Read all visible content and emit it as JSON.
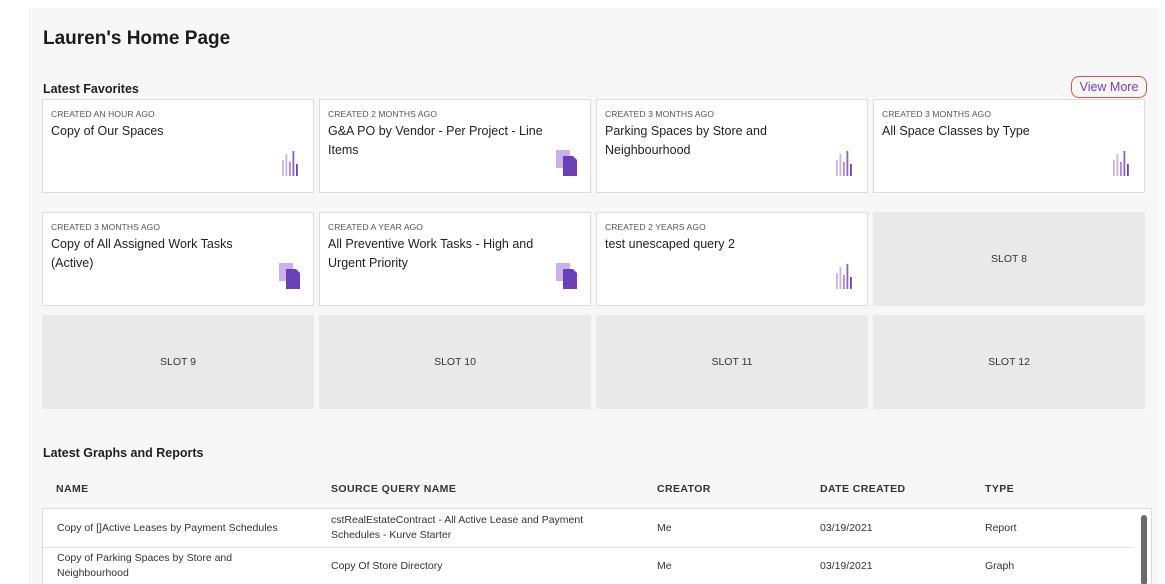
{
  "page": {
    "title": "Lauren's Home Page"
  },
  "favorites": {
    "title": "Latest Favorites",
    "view_more": "View More",
    "cards": [
      {
        "created": "CREATED AN HOUR AGO",
        "name": "Copy of Our Spaces",
        "icon": "bar-chart-icon"
      },
      {
        "created": "CREATED 2 MONTHS AGO",
        "name": "G&A PO by Vendor - Per Project - Line Items",
        "icon": "report-icon"
      },
      {
        "created": "CREATED 3 MONTHS AGO",
        "name": "Parking Spaces by Store and Neighbourhood",
        "icon": "bar-chart-icon"
      },
      {
        "created": "CREATED 3 MONTHS AGO",
        "name": "All Space Classes by Type",
        "icon": "bar-chart-icon"
      },
      {
        "created": "CREATED 3 MONTHS AGO",
        "name": "Copy of All Assigned Work Tasks (Active)",
        "icon": "report-icon"
      },
      {
        "created": "CREATED A YEAR AGO",
        "name": "All Preventive Work Tasks - High and Urgent Priority",
        "icon": "report-icon"
      },
      {
        "created": "CREATED 2 YEARS AGO",
        "name": "test unescaped query 2",
        "icon": "bar-chart-icon"
      }
    ],
    "slots": [
      "SLOT 8",
      "SLOT 9",
      "SLOT 10",
      "SLOT 11",
      "SLOT 12"
    ]
  },
  "reports": {
    "title": "Latest Graphs and Reports",
    "columns": [
      "NAME",
      "SOURCE QUERY NAME",
      "CREATOR",
      "DATE CREATED",
      "TYPE"
    ],
    "rows": [
      {
        "name": "Copy of []Active Leases by Payment Schedules",
        "source": "cstRealEstateContract - All Active Lease and Payment Schedules - Kurve Starter",
        "creator": "Me",
        "date": "03/19/2021",
        "type": "Report"
      },
      {
        "name": "Copy of Parking Spaces by Store and Neighbourhood",
        "source": "Copy Of Store Directory",
        "creator": "Me",
        "date": "03/19/2021",
        "type": "Graph"
      }
    ]
  },
  "colors": {
    "accent": "#6c43c4",
    "icon_light": "#c8b3e8",
    "icon_dark": "#6b3fb8",
    "highlight": "#e0553f"
  }
}
